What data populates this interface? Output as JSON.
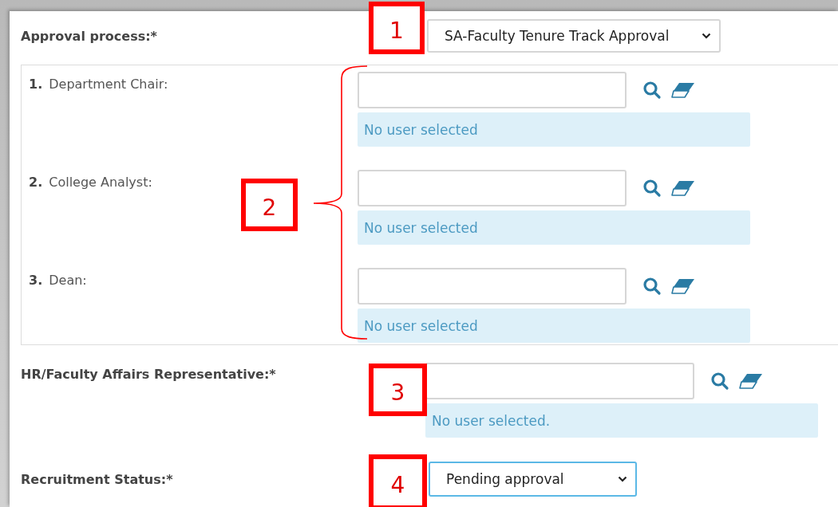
{
  "approval_process": {
    "label": "Approval process:*",
    "value": "SA-Faculty Tenure Track Approval",
    "focused": false
  },
  "approvers": [
    {
      "number": "1.",
      "label": "Department Chair:",
      "status": "No user selected"
    },
    {
      "number": "2.",
      "label": "College Analyst:",
      "status": "No user selected"
    },
    {
      "number": "3.",
      "label": "Dean:",
      "status": "No user selected"
    }
  ],
  "hr_representative": {
    "label": "HR/Faculty Affairs Representative:*",
    "status": "No user selected."
  },
  "recruitment_status": {
    "label": "Recruitment Status:*",
    "value": "Pending approval",
    "focused": true
  },
  "callouts": [
    "1",
    "2",
    "3",
    "4"
  ]
}
